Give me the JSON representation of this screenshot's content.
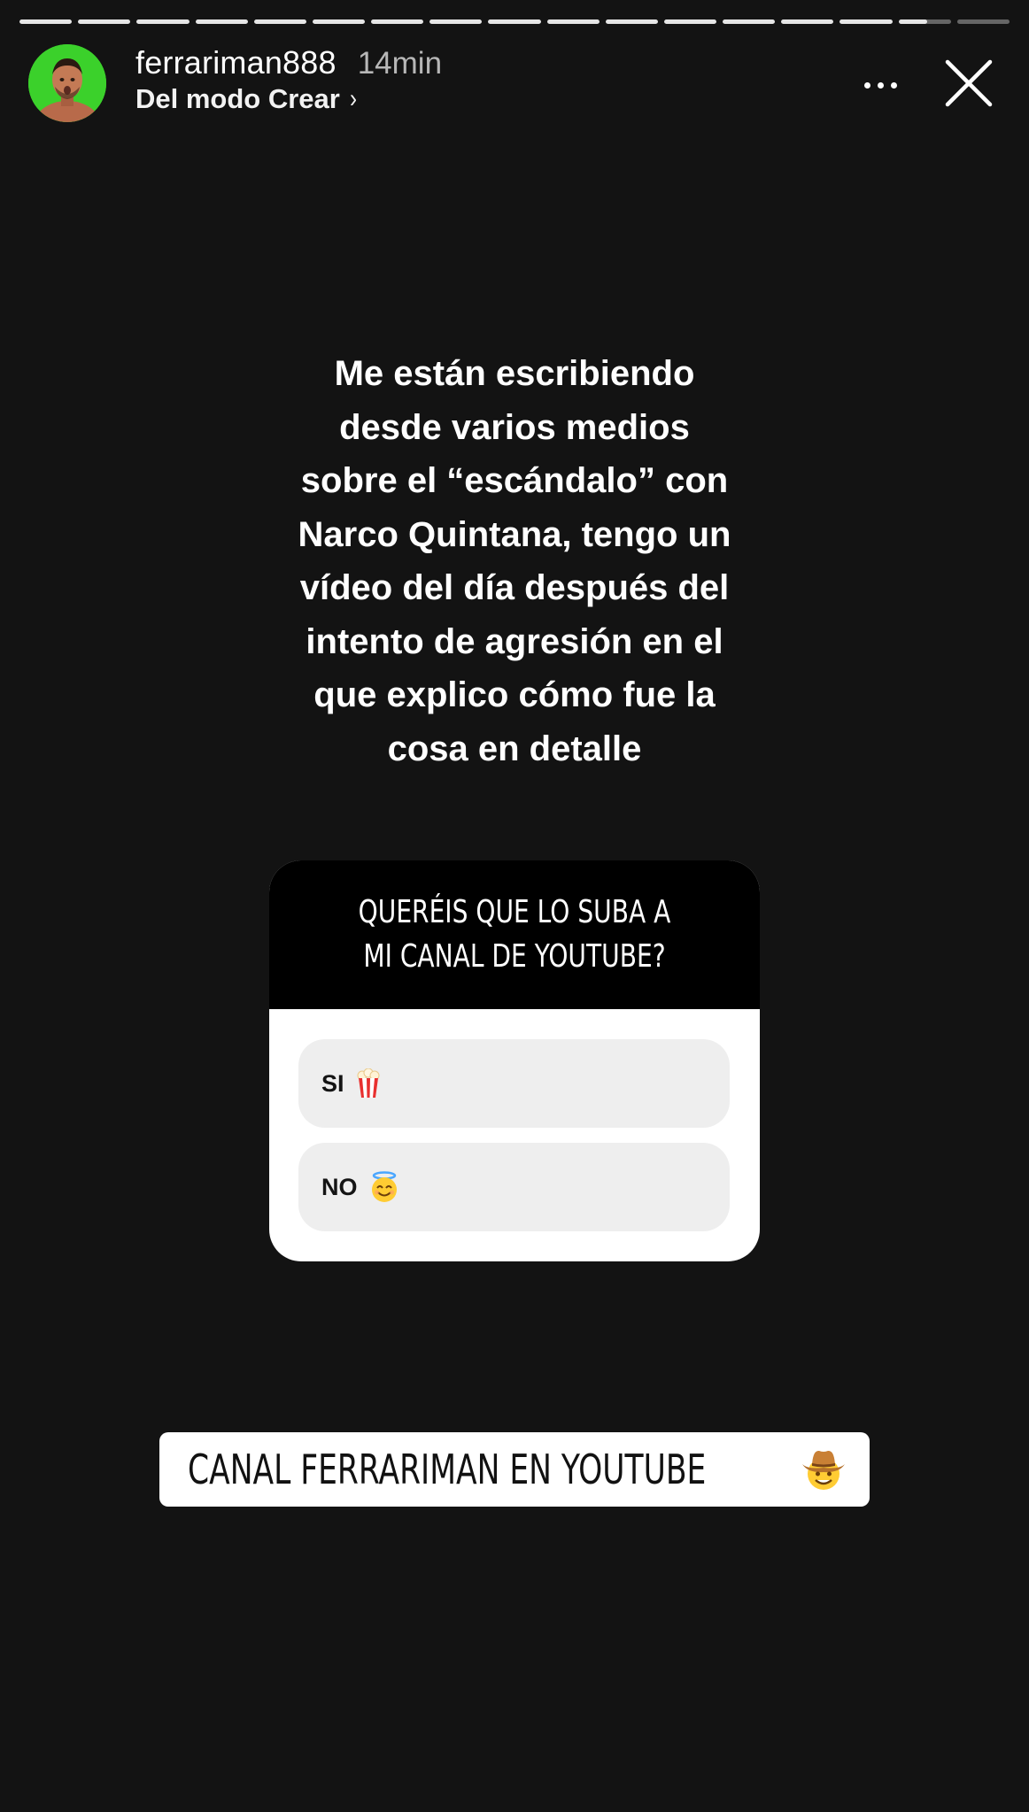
{
  "story": {
    "segments_total": 17,
    "segments_viewed": 15,
    "current_segment_progress": 0.55
  },
  "header": {
    "username": "ferrariman888",
    "time": "14min",
    "subtitle": "Del modo Crear",
    "subtitle_chevron": "›",
    "more_icon": "more-horizontal-icon",
    "close_icon": "close-icon"
  },
  "text": "Me están escribiendo\ndesde varios medios\nsobre el “escándalo” con\nNarco Quintana, tengo un\nvídeo del día después del\nintento de agresión en el\nque explico cómo fue la\ncosa en detalle",
  "poll": {
    "question": "QUERÉIS QUE LO SUBA A MI CANAL DE YOUTUBE?",
    "options": [
      {
        "label": "SI",
        "emoji": "popcorn-icon"
      },
      {
        "label": "NO",
        "emoji": "smiling-face-with-halo-icon"
      }
    ]
  },
  "link_sticker": {
    "label": "CANAL FERRARIMAN EN YOUTUBE",
    "icon": "link-icon",
    "emoji": "cowboy-hat-face-icon"
  },
  "colors": {
    "background": "#131313",
    "avatar_bg": "#3bd12b",
    "link_gradient_start": "#f5358a",
    "link_gradient_end": "#a83ce0"
  }
}
